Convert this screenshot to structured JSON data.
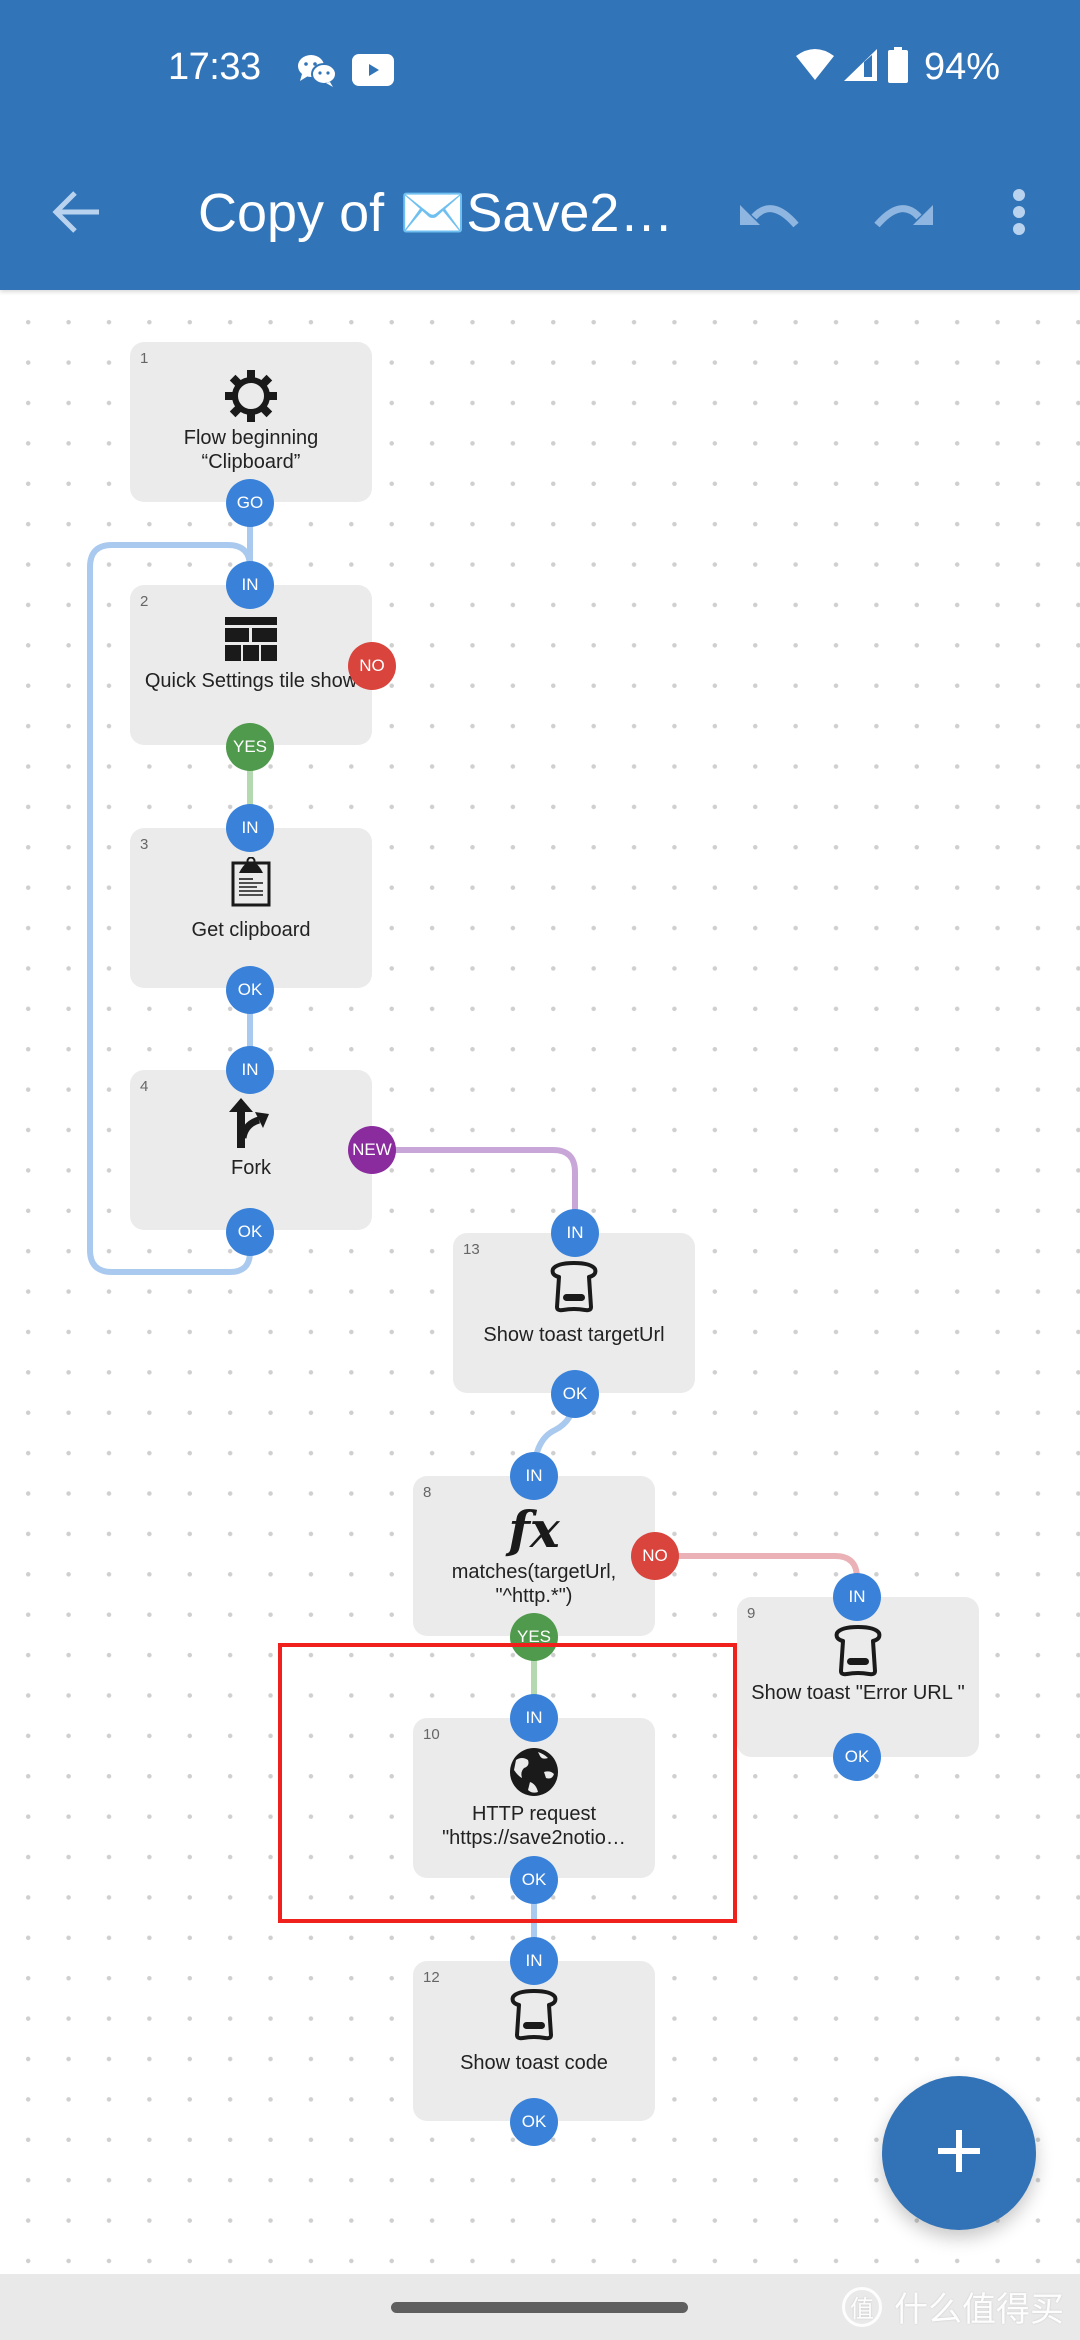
{
  "status_bar": {
    "time": "17:33",
    "left_icons": [
      "wechat-icon",
      "youtube-icon"
    ],
    "right_icons": [
      "wifi-icon",
      "signal-icon",
      "battery-icon"
    ],
    "battery": "94%"
  },
  "toolbar": {
    "back_icon": "arrow-left-icon",
    "title": "Copy of ✉️Save2…",
    "undo_icon": "undo-icon",
    "redo_icon": "redo-icon",
    "more_icon": "more-vertical-icon"
  },
  "colors": {
    "appbar": "#3274b8",
    "pin_blue": "#3a82d9",
    "pin_green": "#4f9a4c",
    "pin_red": "#d9443d",
    "pin_purple": "#8a2b9e",
    "wire_blue": "#a9c9ef",
    "wire_green": "#b4d9b0",
    "wire_red": "#eab2b6",
    "wire_purple": "#c9a6d8",
    "highlight": "#f0211d",
    "node_bg": "#ebebeb"
  },
  "nodes": [
    {
      "id": "1",
      "number": "1",
      "icon": "gear-icon",
      "label": "Flow beginning “Clipboard”",
      "pins": [
        {
          "label": "GO",
          "color": "blue"
        }
      ]
    },
    {
      "id": "2",
      "number": "2",
      "icon": "quick-settings-tile-icon",
      "label": "Quick Settings tile show",
      "pins": [
        {
          "label": "IN",
          "color": "blue"
        },
        {
          "label": "NO",
          "color": "red"
        },
        {
          "label": "YES",
          "color": "green"
        }
      ]
    },
    {
      "id": "3",
      "number": "3",
      "icon": "clipboard-icon",
      "label": "Get clipboard",
      "pins": [
        {
          "label": "IN",
          "color": "blue"
        },
        {
          "label": "OK",
          "color": "blue"
        }
      ]
    },
    {
      "id": "4",
      "number": "4",
      "icon": "fork-icon",
      "label": "Fork",
      "pins": [
        {
          "label": "IN",
          "color": "blue"
        },
        {
          "label": "NEW",
          "color": "purple"
        },
        {
          "label": "OK",
          "color": "blue"
        }
      ]
    },
    {
      "id": "13",
      "number": "13",
      "icon": "toast-icon",
      "label": "Show toast targetUrl",
      "pins": [
        {
          "label": "IN",
          "color": "blue"
        },
        {
          "label": "OK",
          "color": "blue"
        }
      ]
    },
    {
      "id": "8",
      "number": "8",
      "icon": "function-fx-icon",
      "label": "matches(targetUrl, \"^http.*\")",
      "pins": [
        {
          "label": "IN",
          "color": "blue"
        },
        {
          "label": "NO",
          "color": "red"
        },
        {
          "label": "YES",
          "color": "green"
        }
      ]
    },
    {
      "id": "9",
      "number": "9",
      "icon": "toast-icon",
      "label": "Show toast \"Error URL \"",
      "pins": [
        {
          "label": "IN",
          "color": "blue"
        },
        {
          "label": "OK",
          "color": "blue"
        }
      ]
    },
    {
      "id": "10",
      "number": "10",
      "icon": "globe-icon",
      "label": "HTTP request \"https://save2notio…",
      "pins": [
        {
          "label": "IN",
          "color": "blue"
        },
        {
          "label": "OK",
          "color": "blue"
        }
      ]
    },
    {
      "id": "12",
      "number": "12",
      "icon": "toast-icon",
      "label": "Show toast code",
      "pins": [
        {
          "label": "IN",
          "color": "blue"
        },
        {
          "label": "OK",
          "color": "blue"
        }
      ]
    }
  ],
  "connections": [
    {
      "from": "1.GO",
      "to": "2.IN",
      "color": "blue"
    },
    {
      "from": "2.YES",
      "to": "3.IN",
      "color": "green"
    },
    {
      "from": "3.OK",
      "to": "4.IN",
      "color": "blue"
    },
    {
      "from": "4.OK",
      "to": "2.IN",
      "color": "blue"
    },
    {
      "from": "4.NEW",
      "to": "13.IN",
      "color": "purple"
    },
    {
      "from": "13.OK",
      "to": "8.IN",
      "color": "blue"
    },
    {
      "from": "8.NO",
      "to": "9.IN",
      "color": "red"
    },
    {
      "from": "8.YES",
      "to": "10.IN",
      "color": "green"
    },
    {
      "from": "10.OK",
      "to": "12.IN",
      "color": "blue"
    }
  ],
  "highlighted_node": "10",
  "fab": {
    "icon": "plus-icon",
    "label": "+"
  },
  "watermark": {
    "badge": "值",
    "text": "什么值得买"
  }
}
